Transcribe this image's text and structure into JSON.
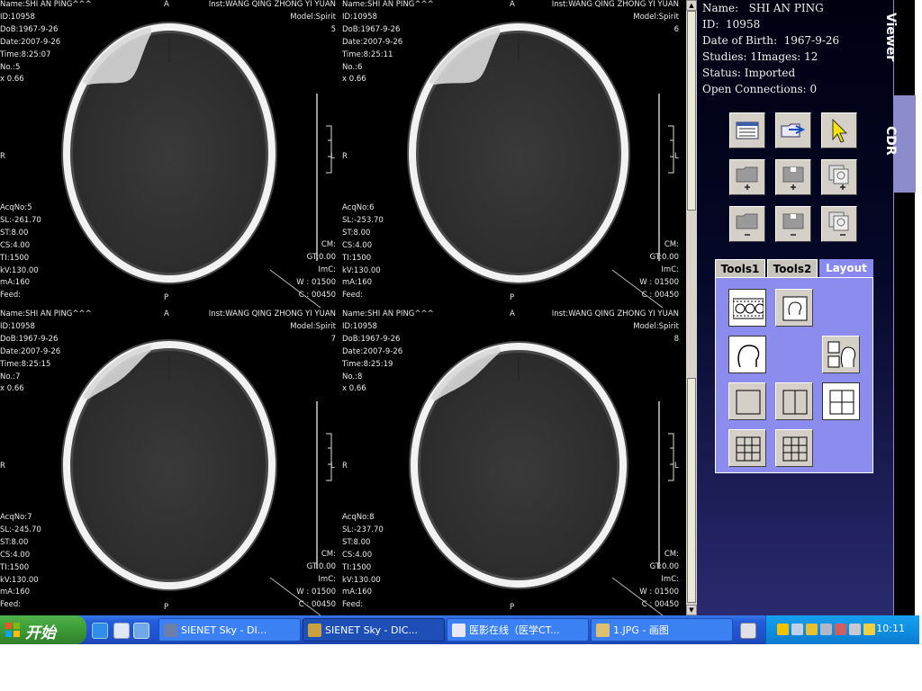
{
  "viewer": {
    "panes": [
      {
        "top_left": "Name:SHI AN PING^^^\nID:10958\nDoB:1967-9-26\nDate:2007-9-26\nTime:8:25:07\nNo.:5\nx 0.66",
        "top_center": "A",
        "top_right": "Inst:WANG QING ZHONG YI YUAN\nModel:Spirit\n5",
        "left_mid": "R",
        "right_mid": "L",
        "bottom_left": "AcqNo:5\nSL:-261.70\nST:8.00\nCS:4.00\nTI:1500\nkV:130.00\nmA:160\nFeed:",
        "bottom_right": "CM:\nGT:0.00\nImC:\nW : 01500\nC : 00450",
        "bottom_center": "P"
      },
      {
        "top_left": "Name:SHI AN PING^^^\nID:10958\nDoB:1967-9-26\nDate:2007-9-26\nTime:8:25:11\nNo.:6\nx 0.66",
        "top_center": "A",
        "top_right": "Inst:WANG QING ZHONG YI YUAN\nModel:Spirit\n6",
        "left_mid": "R",
        "right_mid": "L",
        "bottom_left": "AcqNo:6\nSL:-253.70\nST:8.00\nCS:4.00\nTI:1500\nkV:130.00\nmA:160\nFeed:",
        "bottom_right": "CM:\nGT:0.00\nImC:\nW : 01500\nC : 00450",
        "bottom_center": "P"
      },
      {
        "top_left": "Name:SHI AN PING^^^\nID:10958\nDoB:1967-9-26\nDate:2007-9-26\nTime:8:25:15\nNo.:7\nx 0.66",
        "top_center": "A",
        "top_right": "Inst:WANG QING ZHONG YI YUAN\nModel:Spirit\n7",
        "left_mid": "R",
        "right_mid": "L",
        "bottom_left": "AcqNo:7\nSL:-245.70\nST:8.00\nCS:4.00\nTI:1500\nkV:130.00\nmA:160\nFeed:",
        "bottom_right": "CM:\nGT:0.00\nImC:\nW : 01500\nC : 00450",
        "bottom_center": "P"
      },
      {
        "top_left": "Name:SHI AN PING^^^\nID:10958\nDoB:1967-9-26\nDate:2007-9-26\nTime:8:25:19\nNo.:8\nx 0.66",
        "top_center": "A",
        "top_right": "Inst:WANG QING ZHONG YI YUAN\nModel:Spirit\n8",
        "left_mid": "R",
        "right_mid": "L",
        "bottom_left": "AcqNo:8\nSL:-237.70\nST:8.00\nCS:4.00\nTI:1500\nkV:130.00\nmA:160\nFeed:",
        "bottom_right": "CM:\nGT:0.00\nImC:\nW : 01500\nC : 00450",
        "bottom_center": "P"
      }
    ]
  },
  "scrollbar": {
    "up": "▲",
    "down": "▼"
  },
  "patient": {
    "name": "Name:   SHI AN PING",
    "id": "ID:  10958",
    "dob": "Date of Birth:  1967-9-26",
    "counts": "Studies: 1Images: 12",
    "status": "Status: Imported",
    "connections": "Open Connections: 0"
  },
  "side_tabs": {
    "viewer": "Viewer",
    "cdr": "CDR"
  },
  "toolbar_icons": [
    "list-icon",
    "folder-arrow-icon",
    "cursor-icon",
    "folder-add-icon",
    "box-add-icon",
    "images-add-icon",
    "folder-remove-icon",
    "box-remove-icon",
    "images-remove-icon"
  ],
  "tabs": {
    "tools1": "Tools1",
    "tools2": "Tools2",
    "layout": "Layout"
  },
  "layout_icons": [
    "filmstrip-heads-icon",
    "head-small-icon",
    "head-large-icon",
    "head-grid-icon",
    "layout-1x1-icon",
    "layout-1x2-icon",
    "layout-2x2-icon",
    "layout-3x3-icon",
    "layout-3x3-alt-icon"
  ],
  "taskbar": {
    "start": "开始",
    "tasks": [
      "SIENET Sky - DI...",
      "SIENET Sky - DIC...",
      "医影在线（医学CT...",
      "1.JPG - 画图"
    ],
    "clock": "10:11"
  },
  "colors": {
    "panel_bg": "#05082a",
    "tab_active": "#8888ee",
    "taskbar": "#245edb",
    "start": "#3c9a35",
    "tray": "#0f8fe2"
  }
}
